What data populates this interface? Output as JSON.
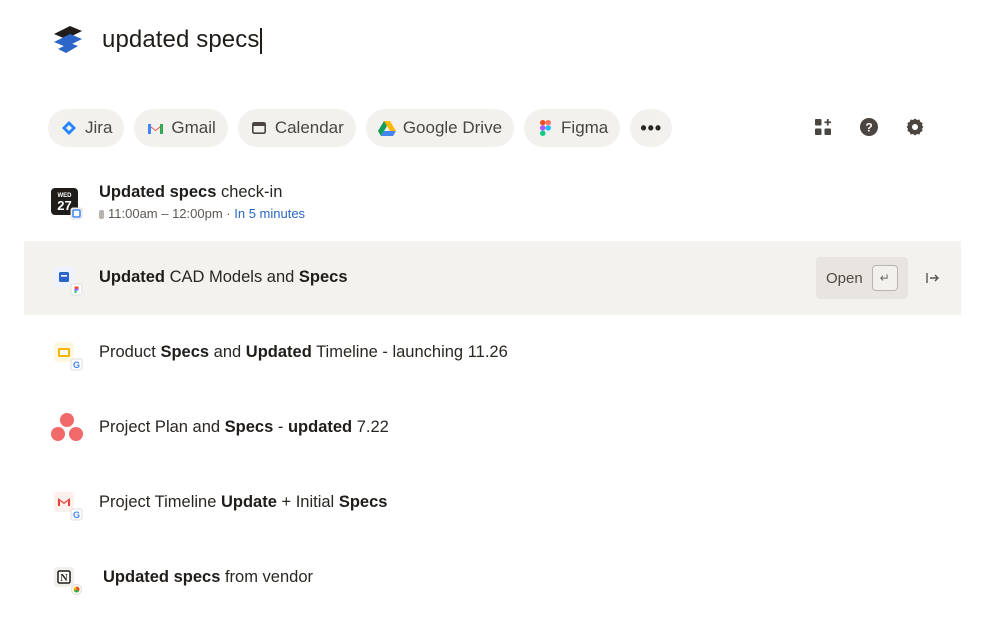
{
  "search": {
    "query": "updated specs",
    "logo_icon": "dropbox-dash-logo"
  },
  "filters": [
    {
      "label": "Jira",
      "icon": "jira-icon"
    },
    {
      "label": "Gmail",
      "icon": "gmail-icon"
    },
    {
      "label": "Calendar",
      "icon": "calendar-icon"
    },
    {
      "label": "Google Drive",
      "icon": "google-drive-icon"
    },
    {
      "label": "Figma",
      "icon": "figma-icon"
    },
    {
      "label": "•••",
      "icon": "more-icon"
    }
  ],
  "tools": [
    "apps-add-icon",
    "help-icon",
    "settings-icon"
  ],
  "results": [
    {
      "parts": [
        {
          "t": "Updated specs",
          "b": true
        },
        {
          "t": " check-in",
          "b": false
        }
      ],
      "subtitle_time": "11:00am – 12:00pm · ",
      "subtitle_soon": "In 5 minutes",
      "icon": "calendar-event-icon",
      "calendar_day": "WED",
      "calendar_date": "27"
    },
    {
      "parts": [
        {
          "t": "Updated",
          "b": true
        },
        {
          "t": " CAD Models and ",
          "b": false
        },
        {
          "t": "Specs",
          "b": true
        }
      ],
      "icon": "figma-file-icon",
      "open_label": "Open",
      "enter_key": "↵"
    },
    {
      "parts": [
        {
          "t": "Product ",
          "b": false
        },
        {
          "t": "Specs",
          "b": true
        },
        {
          "t": " and ",
          "b": false
        },
        {
          "t": "Updated",
          "b": true
        },
        {
          "t": " Timeline - launching 11.26",
          "b": false
        }
      ],
      "icon": "google-slides-icon"
    },
    {
      "parts": [
        {
          "t": "Project Plan and ",
          "b": false
        },
        {
          "t": "Specs",
          "b": true
        },
        {
          "t": " - ",
          "b": false
        },
        {
          "t": "updated",
          "b": true
        },
        {
          "t": " 7.22",
          "b": false
        }
      ],
      "icon": "asana-icon"
    },
    {
      "parts": [
        {
          "t": "Project Timeline ",
          "b": false
        },
        {
          "t": "Update",
          "b": true
        },
        {
          "t": " + Initial ",
          "b": false
        },
        {
          "t": "Specs",
          "b": true
        }
      ],
      "icon": "gmail-message-icon"
    },
    {
      "parts": [
        {
          "t": "Updated specs",
          "b": true
        },
        {
          "t": " from vendor",
          "b": false
        }
      ],
      "icon": "notion-page-icon"
    }
  ],
  "colors": {
    "selected_row": "#f4f2ef",
    "chip_bg": "#f3f1ee",
    "accent_blue": "#2b65c8"
  }
}
